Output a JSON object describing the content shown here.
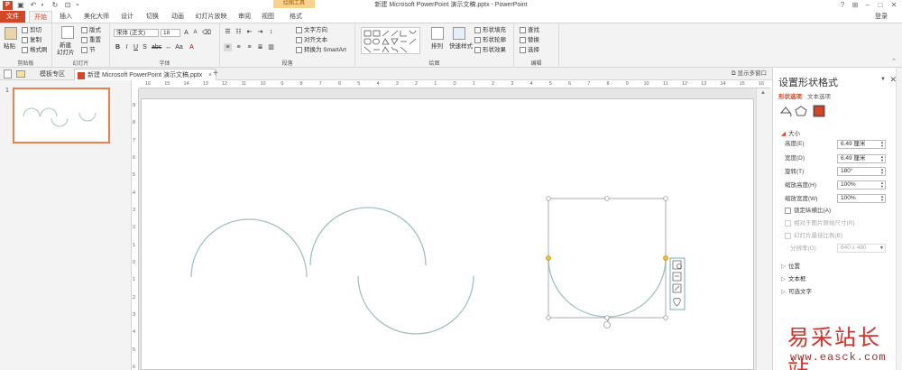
{
  "app": {
    "title": "新建 Microsoft PowerPoint 演示文稿.pptx - PowerPoint",
    "contextual_tools": "绘图工具",
    "login": "登录",
    "accent": "#d24726"
  },
  "tabs": [
    "文件",
    "开始",
    "插入",
    "美化大师",
    "设计",
    "切换",
    "动画",
    "幻灯片放映",
    "审阅",
    "视图",
    "格式"
  ],
  "ribbon": {
    "clipboard": {
      "paste": "粘贴",
      "cut": "剪切",
      "copy": "复制",
      "painter": "格式刷",
      "label": "剪贴板"
    },
    "slides": {
      "new": "新建",
      "new2": "幻灯片",
      "layout": "版式",
      "reset": "重置",
      "section": "节",
      "label": "幻灯片"
    },
    "font": {
      "name": "宋体 (正文)",
      "size": "18",
      "label": "字体"
    },
    "paragraph": {
      "text_dir": "文字方向",
      "align_text": "对齐文本",
      "smartart": "转换为 SmartArt",
      "label": "段落"
    },
    "drawing": {
      "arrange": "排列",
      "quick_styles": "快速样式",
      "fill": "形状填充",
      "outline": "形状轮廓",
      "effects": "形状效果",
      "label": "绘图"
    },
    "editing": {
      "find": "查找",
      "replace": "替换",
      "select": "选择",
      "label": "编辑"
    }
  },
  "doctabs": {
    "template": "模板专区",
    "file": "新建 Microsoft PowerPoint 演示文稿.pptx",
    "show_multi": "显示多窗口"
  },
  "thumbs": [
    {
      "num": "1"
    }
  ],
  "hruler_ticks": [
    "16",
    "15",
    "14",
    "13",
    "12",
    "11",
    "10",
    "9",
    "8",
    "7",
    "6",
    "5",
    "4",
    "3",
    "2",
    "1",
    "0",
    "1",
    "2",
    "3",
    "4",
    "5",
    "6",
    "7",
    "8",
    "9",
    "10",
    "11",
    "12",
    "13",
    "14",
    "15",
    "16"
  ],
  "vruler_ticks": [
    "9",
    "8",
    "7",
    "6",
    "5",
    "4",
    "3",
    "2",
    "1",
    "0",
    "1",
    "2",
    "3",
    "4",
    "5",
    "6"
  ],
  "format_pane": {
    "title": "设置形状格式",
    "tab_shape": "形状选项",
    "tab_text": "文本选项",
    "section_size": "大小",
    "height_label": "高度(E)",
    "height_value": "6.49 厘米",
    "width_label": "宽度(D)",
    "width_value": "6.49 厘米",
    "rotation_label": "旋转(T)",
    "rotation_value": "180°",
    "scale_h_label": "缩放高度(H)",
    "scale_h_value": "100%",
    "scale_w_label": "缩放宽度(W)",
    "scale_w_value": "100%",
    "lock_ratio": "锁定纵横比(A)",
    "relative_orig": "相对于图片原始尺寸(R)",
    "best_scale": "幻灯片最佳比例(B)",
    "resolution_label": "分辨率(O)",
    "resolution_value": "640 x 480",
    "sec_position": "位置",
    "sec_textbox": "文本框",
    "sec_alttext": "可选文字"
  },
  "watermark": {
    "cn": "易采站长站",
    "url": "www.easck.com"
  }
}
